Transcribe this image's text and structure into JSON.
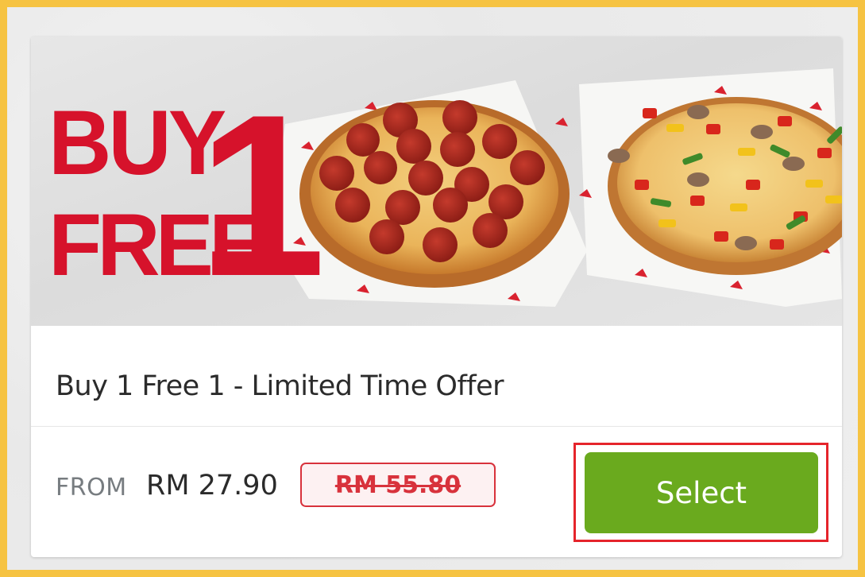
{
  "offer": {
    "banner": {
      "headline_line1": "BUY",
      "headline_line2": "FREE",
      "headline_number": "1",
      "headline_color": "#d6122b",
      "image_alt_items": [
        "pepperoni-pizza",
        "vegetarian-pizza"
      ]
    },
    "title": "Buy 1 Free 1 - Limited Time Offer",
    "pricing": {
      "from_label": "FROM",
      "price": "RM 27.90",
      "original_price": "RM 55.80"
    },
    "select_button": {
      "label": "Select",
      "color": "#6aaa1e"
    },
    "highlight_color": "#e5242b"
  },
  "frame": {
    "border_color": "#f6c342"
  }
}
